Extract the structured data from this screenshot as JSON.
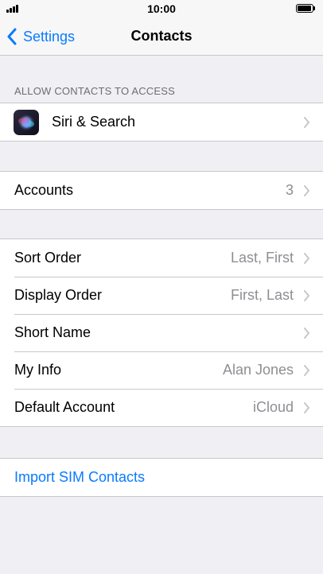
{
  "status_bar": {
    "time": "10:00"
  },
  "nav": {
    "back_label": "Settings",
    "title": "Contacts"
  },
  "access_section": {
    "header": "ALLOW CONTACTS TO ACCESS",
    "items": [
      {
        "label": "Siri & Search",
        "icon": "siri-icon"
      }
    ]
  },
  "accounts": {
    "label": "Accounts",
    "value": "3"
  },
  "settings": [
    {
      "label": "Sort Order",
      "value": "Last, First"
    },
    {
      "label": "Display Order",
      "value": "First, Last"
    },
    {
      "label": "Short Name",
      "value": ""
    },
    {
      "label": "My Info",
      "value": "Alan Jones"
    },
    {
      "label": "Default Account",
      "value": "iCloud"
    }
  ],
  "import": {
    "label": "Import SIM Contacts"
  },
  "colors": {
    "accent": "#0a7aff",
    "background": "#efeff4",
    "secondary_text": "#8e8e93"
  }
}
